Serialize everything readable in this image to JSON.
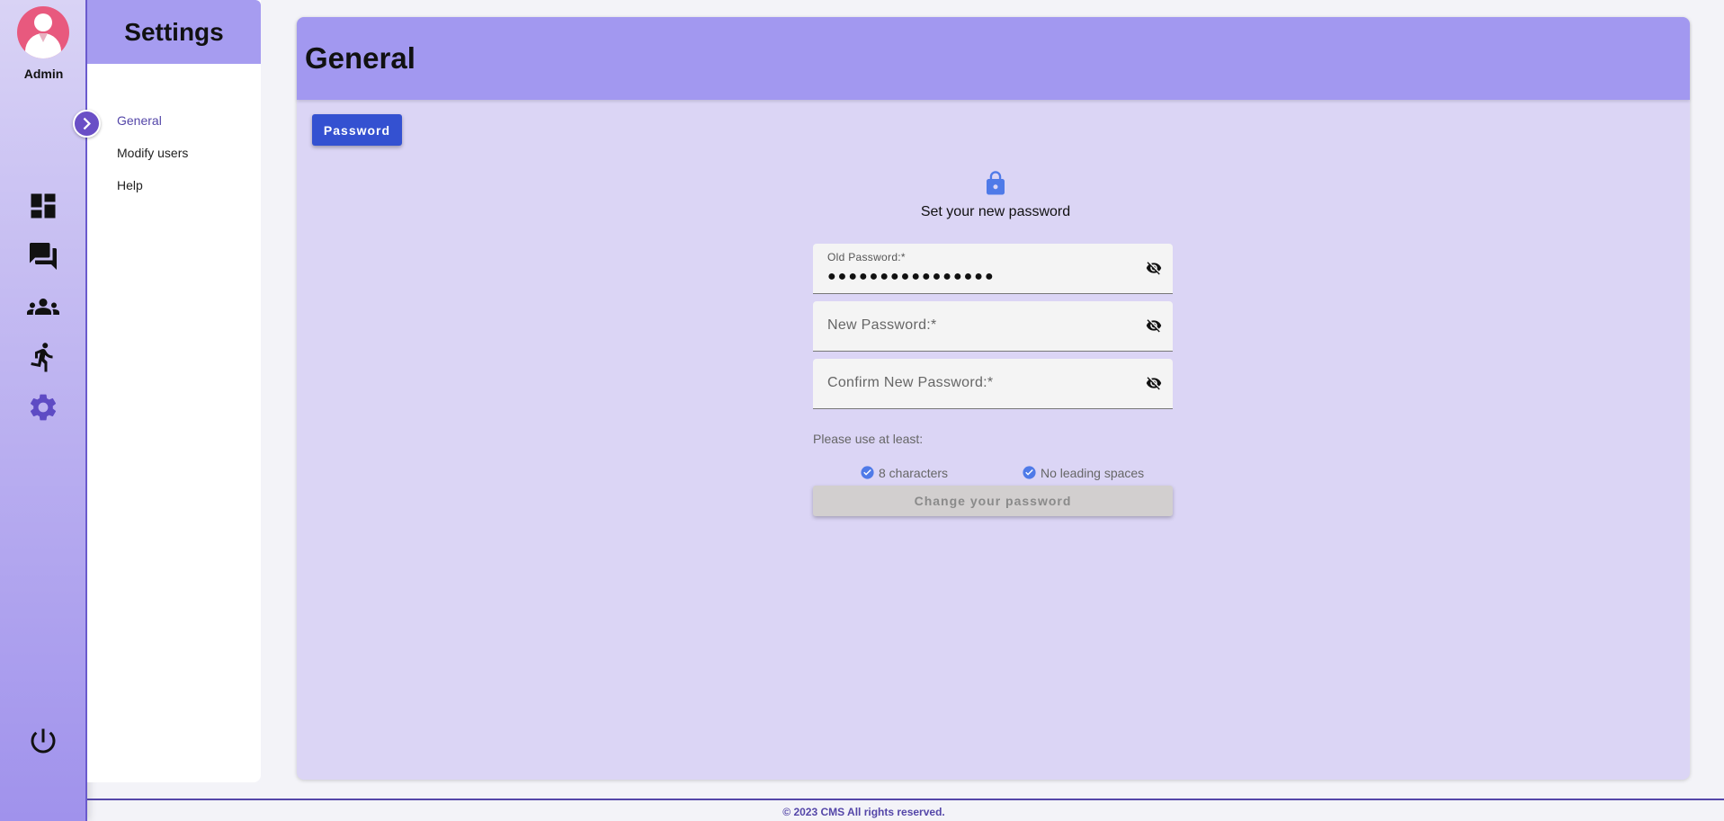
{
  "user": {
    "name": "Admin",
    "avatar_icon": "user-avatar-icon"
  },
  "rail": {
    "items": [
      {
        "name": "dashboard-icon"
      },
      {
        "name": "chat-icon"
      },
      {
        "name": "users-icon"
      },
      {
        "name": "activity-icon"
      },
      {
        "name": "settings-gear-icon"
      }
    ],
    "logout_icon": "power-icon",
    "toggle_icon": "chevron-right-icon"
  },
  "settings": {
    "title": "Settings",
    "items": [
      {
        "label": "General",
        "active": true
      },
      {
        "label": "Modify users",
        "active": false
      },
      {
        "label": "Help",
        "active": false
      }
    ]
  },
  "main": {
    "title": "General",
    "tab_label": "Password",
    "set_title": "Set your new password",
    "fields": {
      "old_password": {
        "label": "Old Password:*",
        "value": "●●●●●●●●●●●●●●●●"
      },
      "new_password": {
        "placeholder": "New Password:*"
      },
      "confirm_password": {
        "placeholder": "Confirm New Password:*"
      }
    },
    "hint": "Please use at least:",
    "requirements": [
      "8 characters",
      "No leading spaces"
    ],
    "submit_label": "Change your password"
  },
  "footer": {
    "text": "© 2023 CMS All rights reserved."
  },
  "colors": {
    "accent": "#3451d1",
    "header": "#a298f0",
    "card": "#dbd5f5",
    "active_text": "#5446a8",
    "check": "#4f7ae8"
  }
}
